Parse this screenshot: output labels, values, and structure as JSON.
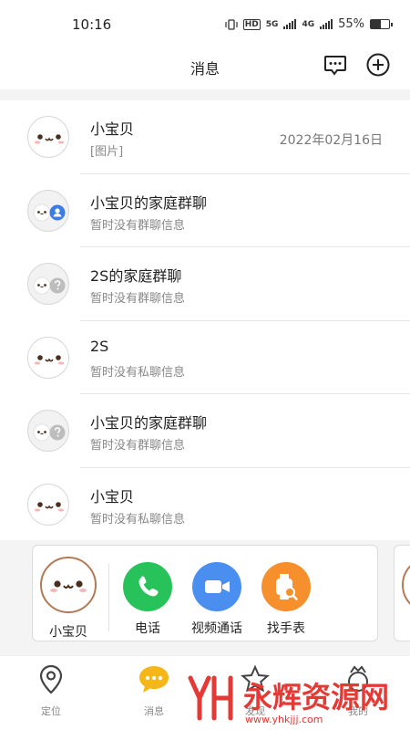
{
  "status_bar": {
    "time": "10:16",
    "hd": "HD",
    "net1": "5G",
    "net2": "4G",
    "battery_text": "55%",
    "battery_level": 0.55
  },
  "header": {
    "title": "消息",
    "message_icon": "chat-bubble-icon",
    "add_icon": "plus-circle-icon"
  },
  "conversations": [
    {
      "name": "小宝贝",
      "subtitle": "[图片]",
      "date": "2022年02月16日",
      "type": "private",
      "status_icon": ""
    },
    {
      "name": "小宝贝的家庭群聊",
      "subtitle": "暂时没有群聊信息",
      "date": "",
      "type": "group",
      "status_icon": "user-badge-icon"
    },
    {
      "name": "2S的家庭群聊",
      "subtitle": "暂时没有群聊信息",
      "date": "",
      "type": "group",
      "status_icon": "question-badge-icon"
    },
    {
      "name": "2S",
      "subtitle": "暂时没有私聊信息",
      "date": "",
      "type": "private",
      "status_icon": ""
    },
    {
      "name": "小宝贝的家庭群聊",
      "subtitle": "暂时没有群聊信息",
      "date": "",
      "type": "group",
      "status_icon": "question-badge-icon"
    },
    {
      "name": "小宝贝",
      "subtitle": "暂时没有私聊信息",
      "date": "",
      "type": "private",
      "status_icon": ""
    }
  ],
  "quick_card": {
    "name": "小宝贝",
    "actions": [
      {
        "label": "电话",
        "icon": "phone-icon",
        "color": "#28c25b"
      },
      {
        "label": "视频通话",
        "icon": "video-camera-icon",
        "color": "#4a8ef0"
      },
      {
        "label": "找手表",
        "icon": "find-watch-icon",
        "color": "#f5902c"
      }
    ]
  },
  "tabbar": {
    "items": [
      {
        "label": "定位",
        "icon": "location-pin-icon"
      },
      {
        "label": "消息",
        "icon": "message-icon"
      },
      {
        "label": "发现",
        "icon": "star-icon"
      },
      {
        "label": "我的",
        "icon": "profile-icon"
      }
    ],
    "active_color": "#f5b617"
  },
  "watermark": {
    "text": "永辉资源网",
    "url": "www.yhkjjj.com"
  }
}
